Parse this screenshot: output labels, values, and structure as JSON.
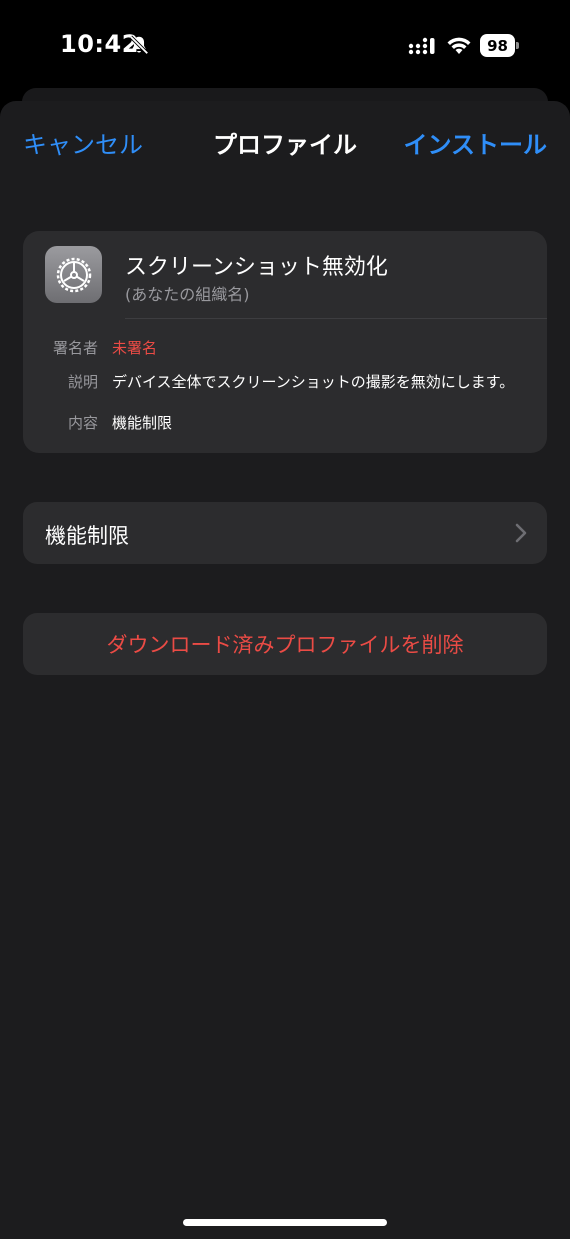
{
  "status_bar": {
    "time": "10:42",
    "battery": "98"
  },
  "nav": {
    "cancel_label": "キャンセル",
    "title": "プロファイル",
    "install_label": "インストール"
  },
  "profile": {
    "name": "スクリーンショット無効化",
    "organization": "(あなたの組織名)",
    "details": [
      {
        "label": "署名者",
        "value": "未署名"
      },
      {
        "label": "説明",
        "value": "デバイス全体でスクリーンショットの撮影を無効にします。"
      },
      {
        "label": "内容",
        "value": "機能制限"
      }
    ]
  },
  "restrictions_row": {
    "label": "機能制限"
  },
  "delete_button": {
    "label": "ダウンロード済みプロファイルを削除"
  },
  "colors": {
    "accent": "#2f8ef8",
    "destructive": "#eb4b45",
    "card_background": "#2c2c2e",
    "sheet_background": "#1c1c1e"
  },
  "icons": {
    "profile": "gear-icon",
    "status_mute": "bell-slash-icon",
    "row_disclosure": "chevron-right-icon"
  }
}
